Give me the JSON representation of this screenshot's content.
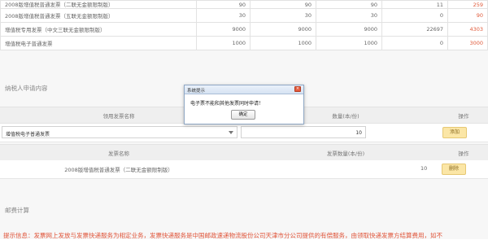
{
  "quota_rows": [
    {
      "name": "2008版增值税普通发票（二联无金额限制版）",
      "c1": "90",
      "c2": "90",
      "c3": "90",
      "c4": "11",
      "c5": "259"
    },
    {
      "name": "2008版增值税普通发票（五联无金额限制版）",
      "c1": "30",
      "c2": "30",
      "c3": "30",
      "c4": "0",
      "c5": "90"
    },
    {
      "name": "增值税专用发票（中文三联无金额限制版）",
      "c1": "9000",
      "c2": "9000",
      "c3": "9000",
      "c4": "22697",
      "c5": "4303"
    },
    {
      "name": "增值税电子普通发票",
      "c1": "1000",
      "c2": "1000",
      "c3": "1000",
      "c4": "0",
      "c5": "3000"
    }
  ],
  "apply_section": {
    "title": "纳税人申请内容",
    "headers": {
      "type": "领用发票名称",
      "qty": "数量(本/份)",
      "op": "操作"
    },
    "selected_invoice": "增值税电子普通发票",
    "quantity_value": "10",
    "add_label": "添加"
  },
  "list_section": {
    "headers": {
      "name": "发票名称",
      "qty": "发票数量(本/份)",
      "op": "操作"
    },
    "rows": [
      {
        "name": "2008版增值税普通发票（二联无金额限制版）",
        "qty": "10",
        "delete_label": "删除"
      }
    ]
  },
  "postage_section": {
    "title": "邮费计算"
  },
  "tip_text": "提示信息：发票网上发放与发票快递服务为相定业务，发票快递服务是中国邮政速递物流股份公司天津市分公司提供的有偿服务，由领取快递发票方结算费用，如不",
  "dialog": {
    "title": "系统提示",
    "message": "电子票不能和其他发票同时申请！",
    "ok_label": "确定",
    "close_glyph": "×"
  },
  "colors": {
    "accent_red": "#e0553a",
    "button_yellow": "#fbe6a6"
  }
}
